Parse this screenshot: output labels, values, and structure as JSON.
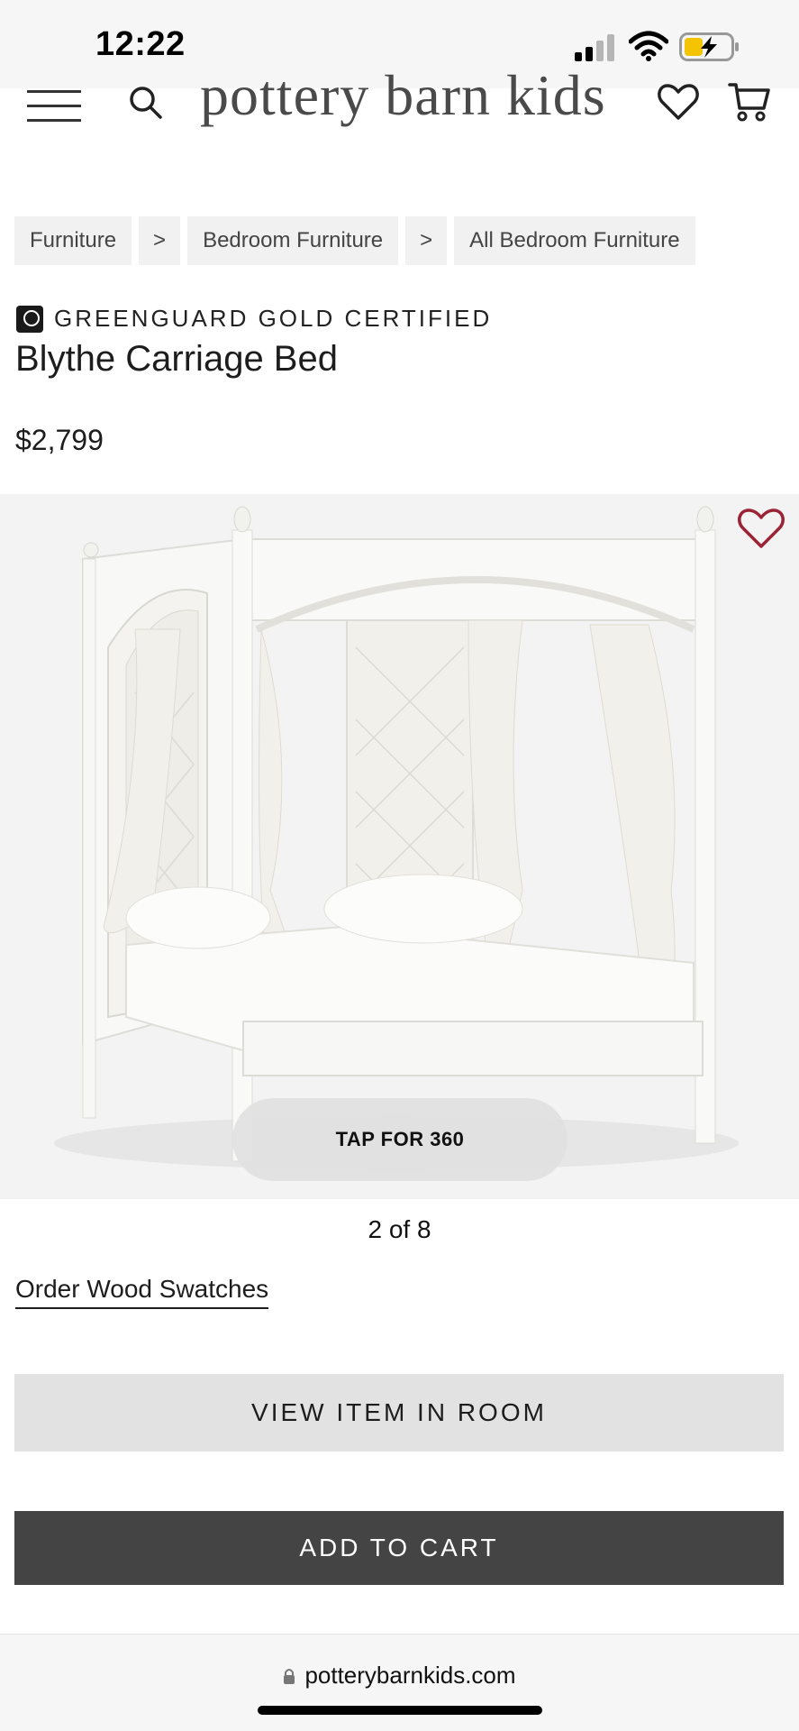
{
  "status_bar": {
    "time": "12:22"
  },
  "header": {
    "brand": "pottery barn kids"
  },
  "breadcrumbs": [
    {
      "label": "Furniture"
    },
    {
      "label": ">"
    },
    {
      "label": "Bedroom Furniture"
    },
    {
      "label": ">"
    },
    {
      "label": "All Bedroom Furniture"
    }
  ],
  "product": {
    "certification": "GREENGUARD GOLD CERTIFIED",
    "title": "Blythe Carriage Bed",
    "price": "$2,799",
    "tap_360_label": "TAP FOR 360",
    "image_counter": "2 of 8",
    "swatches_link": "Order Wood Swatches"
  },
  "actions": {
    "view_in_room": "VIEW ITEM IN ROOM",
    "add_to_cart": "ADD TO CART"
  },
  "browser": {
    "url": "potterybarnkids.com"
  },
  "colors": {
    "favorite_heart": "#9b2335",
    "add_to_cart_bg": "#444444",
    "secondary_button_bg": "#e2e2e2"
  }
}
